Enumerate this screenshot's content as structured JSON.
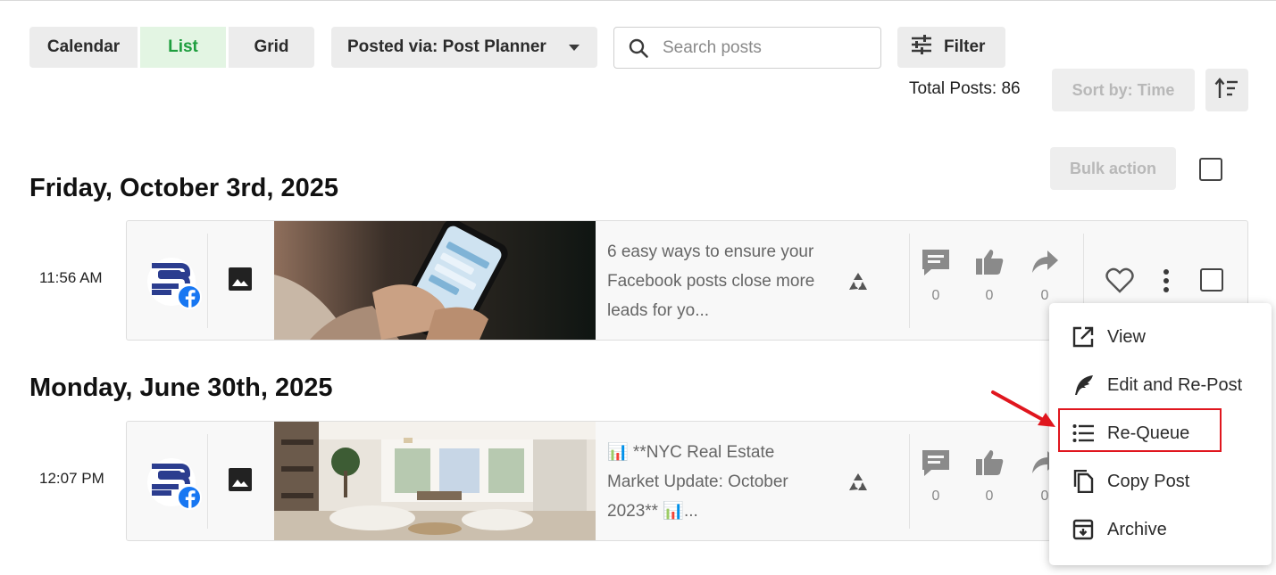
{
  "toolbar": {
    "views": {
      "calendar": "Calendar",
      "list": "List",
      "grid": "Grid"
    },
    "posted_via": "Posted via: Post Planner",
    "search_placeholder": "Search posts",
    "filter_label": "Filter",
    "total_posts": "Total Posts: 86",
    "sort_label": "Sort by: Time",
    "bulk_action": "Bulk action"
  },
  "colors": {
    "accent_green": "#1e9e3e",
    "facebook_blue": "#1877f2",
    "logo_blue": "#2b3d8f",
    "annotation_red": "#e0161e"
  },
  "groups": [
    {
      "date": "Friday, October 3rd, 2025",
      "post": {
        "time": "11:56 AM",
        "network_icon": "facebook-icon",
        "media_type_icon": "image-icon",
        "text": "6 easy ways to ensure your Facebook posts close more leads for yo...",
        "comments": "0",
        "likes": "0",
        "shares": "0"
      }
    },
    {
      "date": "Monday, June 30th, 2025",
      "post": {
        "time": "12:07 PM",
        "network_icon": "facebook-icon",
        "media_type_icon": "image-icon",
        "text": "📊 **NYC Real Estate Market Update: October 2023** 📊...",
        "comments": "0",
        "likes": "0",
        "shares": "0"
      }
    }
  ],
  "menu": {
    "items": [
      {
        "label": "View",
        "icon": "open-external-icon"
      },
      {
        "label": "Edit and Re-Post",
        "icon": "feather-icon"
      },
      {
        "label": "Re-Queue",
        "icon": "list-icon"
      },
      {
        "label": "Copy Post",
        "icon": "copy-icon"
      },
      {
        "label": "Archive",
        "icon": "archive-icon"
      }
    ],
    "highlighted": "Re-Queue"
  }
}
